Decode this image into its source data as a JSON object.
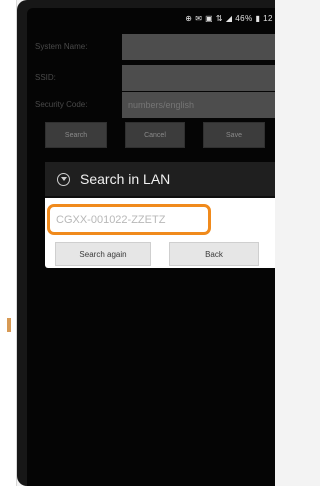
{
  "status_bar": {
    "text": "⊕ ✉ ▣ ⇅ ◢ 46% ▮ 12"
  },
  "form": {
    "system_name": {
      "label": "System Name:",
      "value": ""
    },
    "ssid": {
      "label": "SSID:",
      "value": ""
    },
    "security_code": {
      "label": "Security Code:",
      "placeholder": "numbers/english"
    }
  },
  "buttons": {
    "search": "Search",
    "cancel": "Cancel",
    "save": "Save"
  },
  "dialog": {
    "title": "Search in LAN",
    "device_id": "CGXX-001022-ZZETZ",
    "search_again": "Search again",
    "back": "Back"
  },
  "colors": {
    "highlight": "#f08a1c",
    "field": "#4d4d4d",
    "screen": "#050505"
  }
}
